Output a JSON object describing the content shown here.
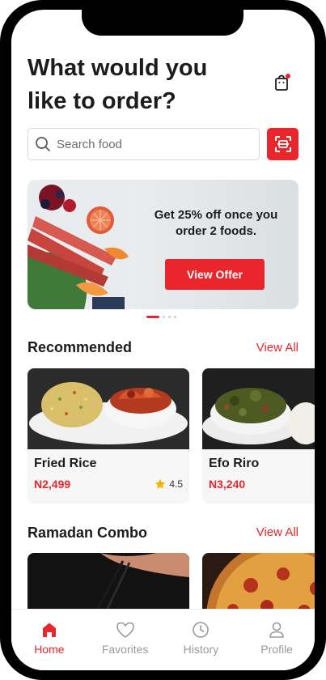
{
  "header": {
    "title": "What would you like to order?",
    "cart_icon": "shopping-bag-icon",
    "cart_badge_color": "#e8262c"
  },
  "search": {
    "placeholder": "Search food",
    "search_icon": "search-icon",
    "scan_icon": "scan-icon"
  },
  "banner": {
    "headline": "Get 25% off once you order 2 foods.",
    "button_label": "View Offer",
    "carousel_pages": 4,
    "active_page": 1
  },
  "sections": [
    {
      "title": "Recommended",
      "view_all_label": "View All",
      "items": [
        {
          "name": "Fried Rice",
          "price": "N2,499",
          "rating": "4.5"
        },
        {
          "name": "Efo Riro",
          "price": "N3,240"
        }
      ]
    },
    {
      "title": "Ramadan Combo",
      "view_all_label": "View All"
    }
  ],
  "nav": {
    "items": [
      {
        "label": "Home",
        "icon": "home-icon",
        "active": true
      },
      {
        "label": "Favorites",
        "icon": "heart-icon",
        "active": false
      },
      {
        "label": "History",
        "icon": "clock-icon",
        "active": false
      },
      {
        "label": "Profile",
        "icon": "user-icon",
        "active": false
      }
    ]
  },
  "colors": {
    "accent": "#e8262c",
    "text": "#1c1c1c",
    "muted": "#9a9a9a",
    "star": "#f0b400"
  }
}
